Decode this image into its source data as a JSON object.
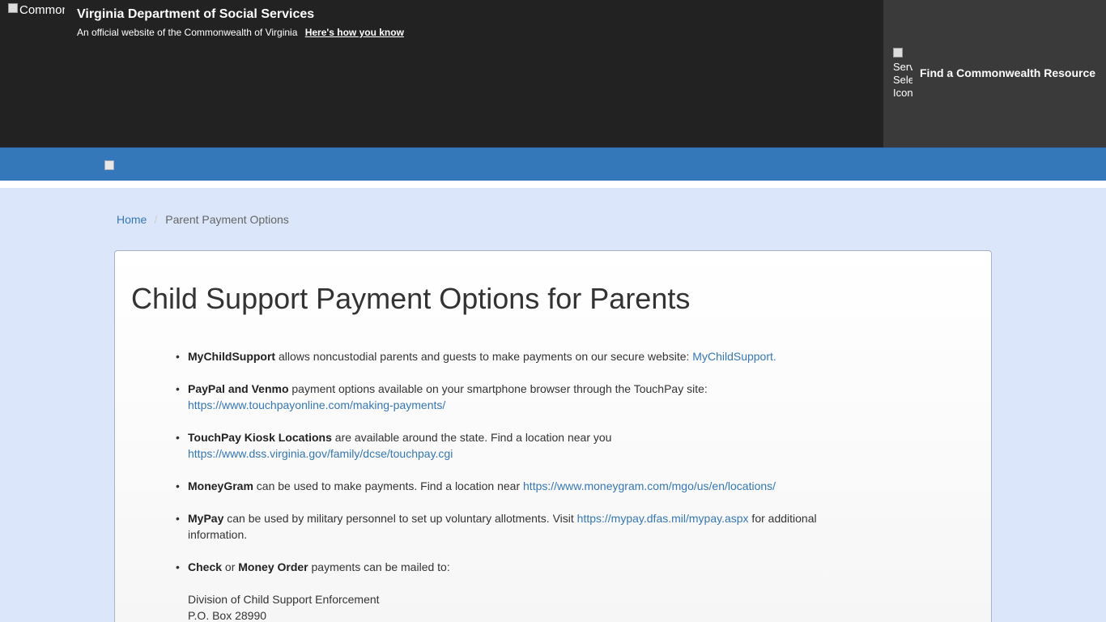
{
  "banner": {
    "seal_alt": "Commonwealth",
    "agency_title": "Virginia Department of Social Services",
    "official_text": "An official website of the Commonwealth of Virginia",
    "how_link": "Here's how you know",
    "resource_icon_alt": "Service Selector Icon",
    "resource_label": "Find a Commonwealth Resource"
  },
  "breadcrumb": {
    "home": "Home",
    "separator": "/",
    "current": "Parent Payment Options"
  },
  "main": {
    "title": "Child Support Payment Options for Parents",
    "options": [
      {
        "bold": "MyChildSupport",
        "text": " allows noncustodial parents and guests to make payments on our secure website: ",
        "link": "MyChildSupport."
      },
      {
        "bold": "PayPal and Venmo",
        "text": " payment options available on your smartphone browser through the TouchPay site:",
        "link": "https://www.touchpayonline.com/making-payments/"
      },
      {
        "bold": "TouchPay Kiosk Locations",
        "text": " are available around the state. Find a location near you",
        "link": "https://www.dss.virginia.gov/family/dcse/touchpay.cgi"
      },
      {
        "bold": "MoneyGram",
        "text": " can be used to make payments. Find a location near ",
        "link": "https://www.moneygram.com/mgo/us/en/locations/"
      },
      {
        "bold": "MyPay",
        "text": " can be used by military personnel to set up voluntary allotments. Visit ",
        "link": "https://mypay.dfas.mil/mypay.aspx",
        "after": " for additional information."
      },
      {
        "bold": "Check",
        "mid": " or ",
        "bold2": "Money Order",
        "text": " payments can be mailed to:",
        "address": [
          "Division of Child Support Enforcement",
          "P.O. Box 28990"
        ]
      }
    ]
  },
  "colors": {
    "banner": "#222222",
    "resource_panel": "#3a3a3a",
    "nav": "#3578ba",
    "link": "#3577b6",
    "page_bg": "#dbe6fb"
  }
}
